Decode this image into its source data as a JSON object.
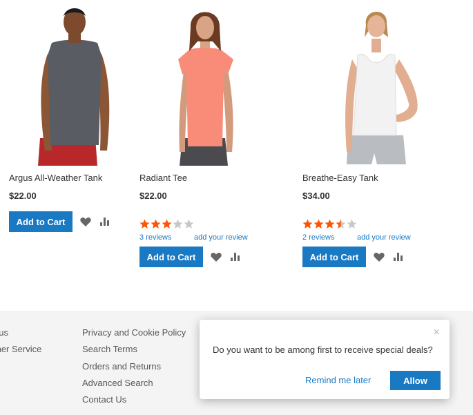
{
  "products": [
    {
      "name": "Argus All-Weather Tank",
      "price": "$22.00",
      "add_to_cart": "Add to Cart",
      "icons": [
        "heart-icon",
        "compare-icon"
      ]
    },
    {
      "name": "Radiant Tee",
      "price": "$22.00",
      "rating": 3,
      "rating_max": 5,
      "reviews_label": "3  reviews",
      "add_review_label": "add your review",
      "add_to_cart": "Add to Cart",
      "icons": [
        "heart-icon",
        "compare-icon"
      ]
    },
    {
      "name": "Breathe-Easy Tank",
      "price": "$34.00",
      "rating": 3.5,
      "rating_max": 5,
      "reviews_label": "2  reviews",
      "add_review_label": "add your review",
      "add_to_cart": "Add to Cart",
      "icons": [
        "heart-icon",
        "compare-icon"
      ]
    }
  ],
  "footer": {
    "col1": [
      "t us",
      "mer Service"
    ],
    "col2": [
      "Privacy and Cookie Policy",
      "Search Terms",
      "Orders and Returns",
      "Advanced Search",
      "Contact Us"
    ]
  },
  "popup": {
    "message": "Do you want to be among first to receive special deals?",
    "later_label": "Remind me later",
    "allow_label": "Allow",
    "close_glyph": "×"
  },
  "colors": {
    "accent": "#1979c3",
    "star_filled": "#ff5501",
    "star_empty": "#c7c7c7",
    "footer_bg": "#f4f4f4"
  }
}
